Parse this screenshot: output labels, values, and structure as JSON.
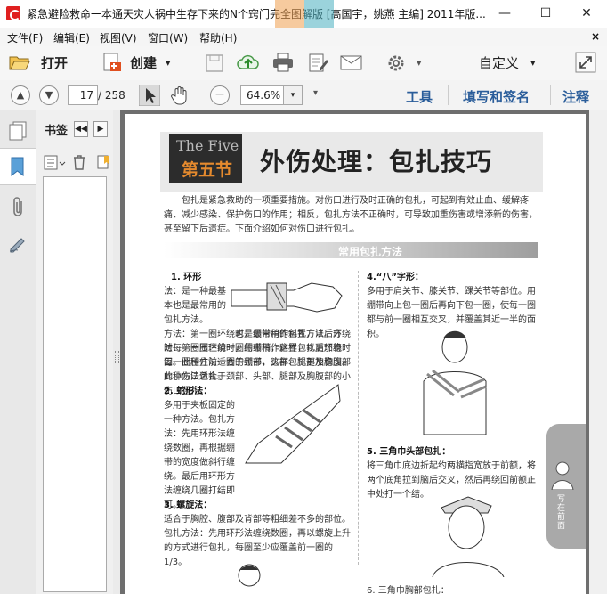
{
  "window": {
    "title": "紧急避险救命一本通天灾人祸中生存下来的N个窍门完全图解版 [高国宇，姚燕 主编] 2011年版...",
    "minimize": "—",
    "maximize": "☐",
    "close": "✕"
  },
  "menu": {
    "items": [
      "文件(F)",
      "编辑(E)",
      "视图(V)",
      "窗口(W)",
      "帮助(H)"
    ],
    "close": "×"
  },
  "toolbar": {
    "open_label": "打开",
    "create_label": "创建",
    "create_caret": "▾",
    "customize_label": "自定义",
    "customize_caret": "▾"
  },
  "nav": {
    "current_page": "17",
    "total_pages": "/ 258",
    "zoom": "64.6%",
    "zoom_caret": "▾",
    "tools_link": "工具",
    "sign_link": "填写和签名",
    "comment_link": "注释"
  },
  "bookmarks": {
    "title": "书签",
    "collapse": "◀◀",
    "expand": "▶"
  },
  "document": {
    "section_en": "The Five",
    "section_zh": "第五节",
    "heading": "外伤处理：包扎技巧",
    "intro": "包扎是紧急救助的一项重要措施。对伤口进行及时正确的包扎，可起到有效止血、缓解疼痛、减少感染、保护伤口的作用；相反，包扎方法不正确时，可导致加重伤害或增添新的伤害，甚至留下后遗症。下面介绍如何对伤口进行包扎。",
    "subheading": "常用包扎方法",
    "left_p1_num": "1. 环形",
    "left_p1": "法：是一种最基本也是最常用的包扎方法。方法：第一圈环绕时，绷带稍作斜置，以后环绕时每一圈压住前一圈的绷带，这样包扎更加稳固。此种方法适合于颈部、头部、腿部及胸腹部的小伤口包扎。",
    "left_p2_num": "2. 蛇形法：",
    "left_p2": "多用于夹板固定的一种方法。包扎方法：先用环形法缠绕数圈，再根据绷带的宽度做斜行缠绕。最后用环形方法缠绕几圈打结即可。",
    "left_p3_num": "3. 螺旋法：",
    "left_p3": "适合于胸腔、腹部及背部等粗细差不多的部位。包扎方法：先用环形法缠绕数圈，再以螺旋上升的方式进行包扎，每圈至少应覆盖前一圈的1/3。",
    "right_p4_num": "4.“八”字形：",
    "right_p4": "多用于肩关节、膝关节、踝关节等部位。用绷带向上包一圈后再向下包一圈，使每一圈都与前一圈相互交叉，并覆盖其近一半的面积。",
    "right_p5_num": "5. 三角巾头部包扎：",
    "right_p5": "将三角巾底边折起约两横指宽放于前额，将两个底角拉到脑后交叉，然后再绕回前额正中处打一个结。",
    "right_p6": "6. 三角巾胸部包扎：",
    "side_tab": "写在前面"
  }
}
